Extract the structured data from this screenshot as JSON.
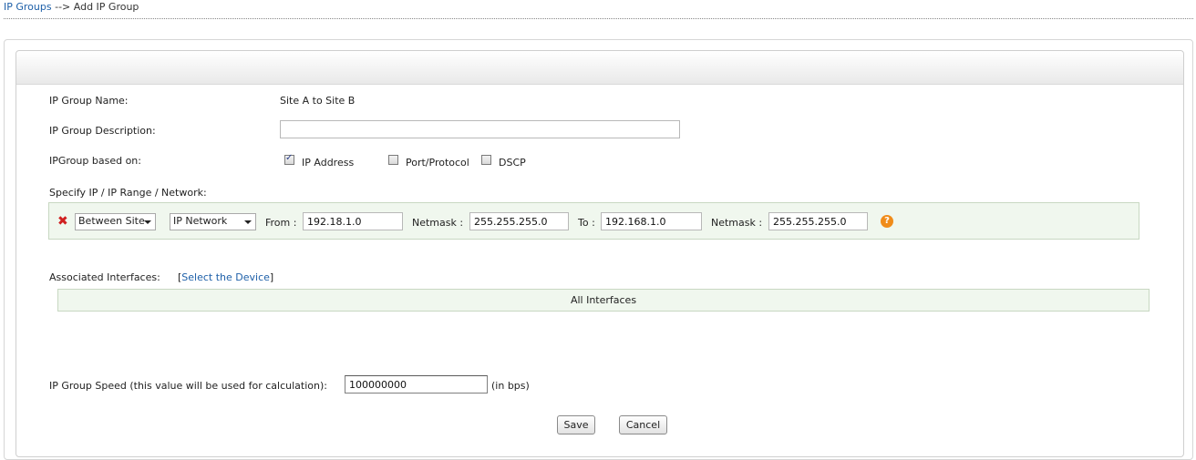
{
  "breadcrumb": {
    "link": "IP Groups",
    "separator": "-->",
    "current": "Add IP Group"
  },
  "form": {
    "name_label": "IP Group Name:",
    "name_value": "Site A to Site B",
    "description_label": "IP Group Description:",
    "description_value": "",
    "based_on_label": "IPGroup based on:",
    "based_on_options": [
      {
        "label": "IP Address",
        "checked": true
      },
      {
        "label": "Port/Protocol",
        "checked": false
      },
      {
        "label": "DSCP",
        "checked": false
      }
    ],
    "specify_label": "Specify IP / IP Range / Network:",
    "range_row": {
      "scope_select": "Between Site",
      "type_select": "IP Network",
      "from_label": "From :",
      "from_value": "192.18.1.0",
      "netmask1_label": "Netmask :",
      "netmask1_value": "255.255.255.0",
      "to_label": "To :",
      "to_value": "192.168.1.0",
      "netmask2_label": "Netmask :",
      "netmask2_value": "255.255.255.0",
      "help_glyph": "?"
    },
    "interfaces_label": "Associated Interfaces:",
    "interfaces_link": "Select the Device",
    "interfaces_value": "All Interfaces",
    "speed_label": "IP Group Speed (this value will be used for calculation):",
    "speed_value": "100000000",
    "speed_unit": "(in bps)",
    "save_label": "Save",
    "cancel_label": "Cancel"
  },
  "icons": {
    "delete": "delete-icon",
    "help": "help-icon"
  },
  "colors": {
    "link": "#1d5fa8",
    "delete": "#d02020",
    "help": "#f08c1a",
    "row_bg": "#f0f7ee"
  }
}
